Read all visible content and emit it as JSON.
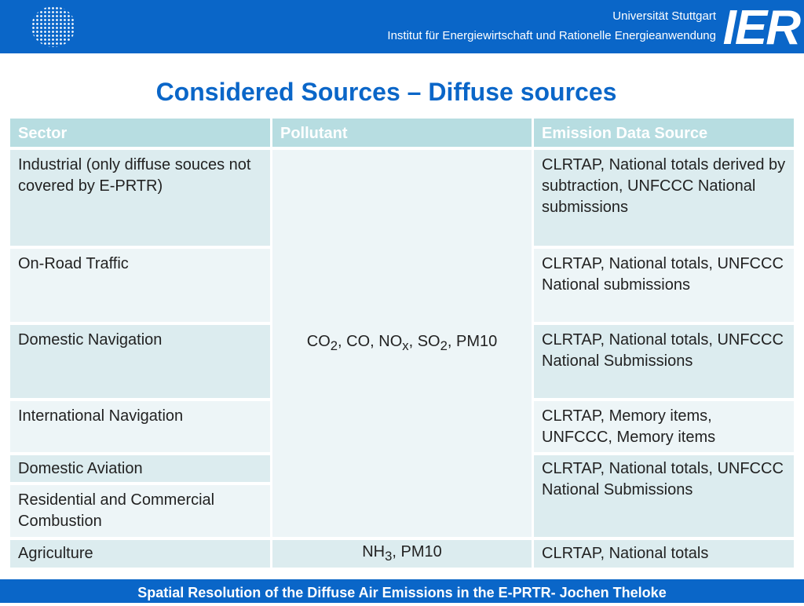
{
  "header": {
    "university": "Universität Stuttgart",
    "institute": "Institut für Energiewirtschaft und Rationelle Energieanwendung",
    "logo_text": "IER"
  },
  "title": "Considered Sources – Diffuse sources",
  "table": {
    "headers": [
      "Sector",
      "Pollutant",
      "Emission Data Source"
    ],
    "sectors": [
      "Industrial (only diffuse souces not covered by E-PRTR)",
      "On-Road Traffic",
      "Domestic Navigation",
      "International Navigation",
      "Domestic Aviation",
      "Residential and Commercial Combustion",
      "Agriculture"
    ],
    "pollutant_main": {
      "p1": "CO",
      "s1": "2",
      "p2": ", CO, NO",
      "s2": "x",
      "p3": ", SO",
      "s3": "2",
      "p4": ", PM10"
    },
    "pollutant_agri": {
      "p1": "NH",
      "s1": "3",
      "p2": ", PM10"
    },
    "sources": [
      "CLRTAP, National totals derived by subtraction, UNFCCC National submissions",
      "CLRTAP, National totals, UNFCCC National submissions",
      "CLRTAP, National totals, UNFCCC National Submissions",
      "CLRTAP, Memory items, UNFCCC, Memory items",
      "CLRTAP, National totals, UNFCCC National Submissions",
      "CLRTAP, National totals"
    ]
  },
  "footer": "Spatial Resolution of the Diffuse Air Emissions in the E-PRTR- Jochen Theloke"
}
